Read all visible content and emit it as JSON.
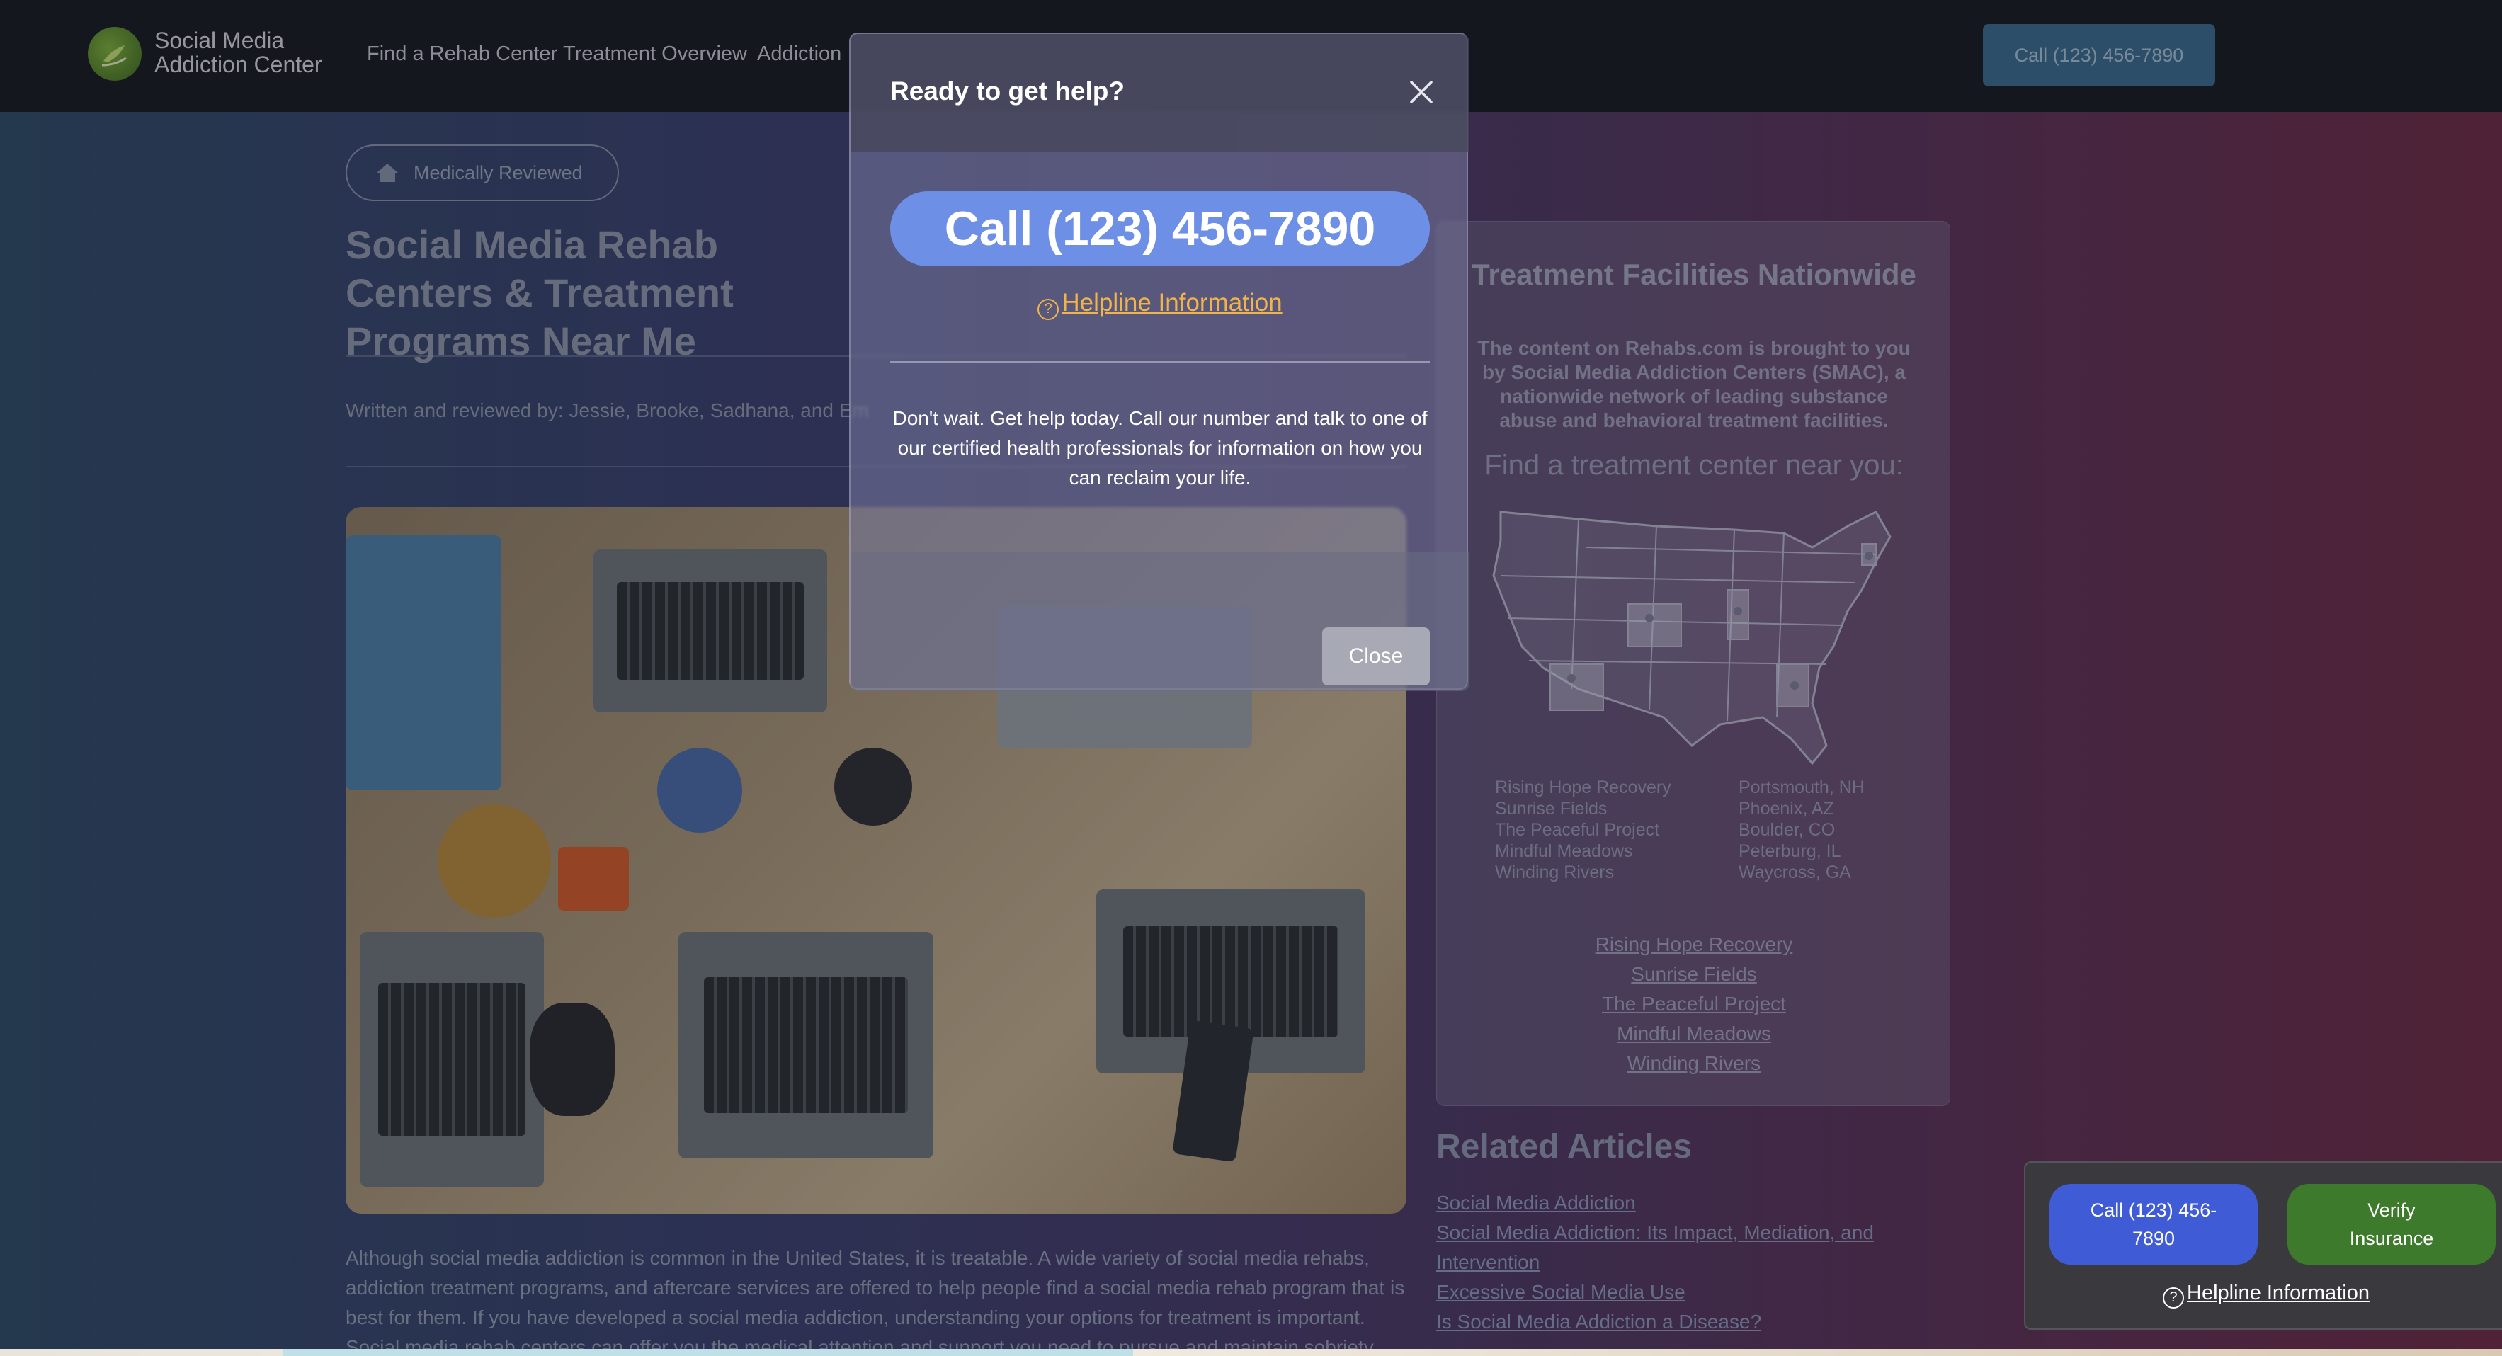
{
  "header": {
    "logo_line1": "Social Media",
    "logo_line2": "Addiction Center",
    "nav": [
      "Find a Rehab Center",
      "Treatment Overview",
      "Addiction"
    ],
    "call_button": "Call (123) 456-7890"
  },
  "article": {
    "badge": "Medically Reviewed",
    "title": "Social Media Rehab Centers & Treatment Programs Near Me",
    "byline": "Written and reviewed by: Jessie, Brooke, Sadhana, and Em",
    "intro": "Although social media addiction is common in the United States, it is treatable. A wide variety of social media rehabs, addiction treatment programs, and aftercare services are offered to help people find a social media rehab program that is best for them. If you have developed a social media addiction, understanding your options for treatment is important. Social media rehab centers can offer you the medical attention and support you need to pursue and maintain sobriety."
  },
  "sidebar": {
    "title": "Treatment Facilities Nationwide",
    "description": "The content on Rehabs.com is brought to you by Social Media Addiction Centers (SMAC), a nationwide network of leading substance abuse and behavioral treatment facilities.",
    "find_prompt": "Find a treatment center near you:",
    "centers": [
      {
        "name": "Rising Hope Recovery",
        "location": "Portsmouth, NH"
      },
      {
        "name": "Sunrise Fields",
        "location": "Phoenix, AZ"
      },
      {
        "name": "The Peaceful Project",
        "location": "Boulder, CO"
      },
      {
        "name": "Mindful Meadows",
        "location": "Peterburg, IL"
      },
      {
        "name": "Winding Rivers",
        "location": "Waycross, GA"
      }
    ],
    "links": [
      "Rising Hope Recovery",
      "Sunrise Fields",
      "The Peaceful Project",
      "Mindful Meadows",
      "Winding Rivers"
    ]
  },
  "related": {
    "title": "Related Articles",
    "links": [
      "Social Media Addiction",
      "Social Media Addiction: Its Impact, Mediation, and Intervention",
      "Excessive Social Media Use",
      "Is Social Media Addiction a Disease?"
    ]
  },
  "modal": {
    "title": "Ready to get help?",
    "big_call": "Call (123) 456-7890",
    "helpline": "Helpline Information",
    "body": "Don't wait. Get help today. Call our number and talk to one of our certified health professionals for information on how you can reclaim your life.",
    "close_button": "Close"
  },
  "float_widget": {
    "call": "Call (123) 456-7890",
    "verify": "Verify Insurance",
    "helpline": "Helpline Information"
  },
  "colors": {
    "header_bg": "#181a1f",
    "modal_call": "#6d8fe6",
    "helpline_link": "#f0b44a",
    "widget_call": "#3f5bd6",
    "widget_verify": "#3e7a2c"
  }
}
